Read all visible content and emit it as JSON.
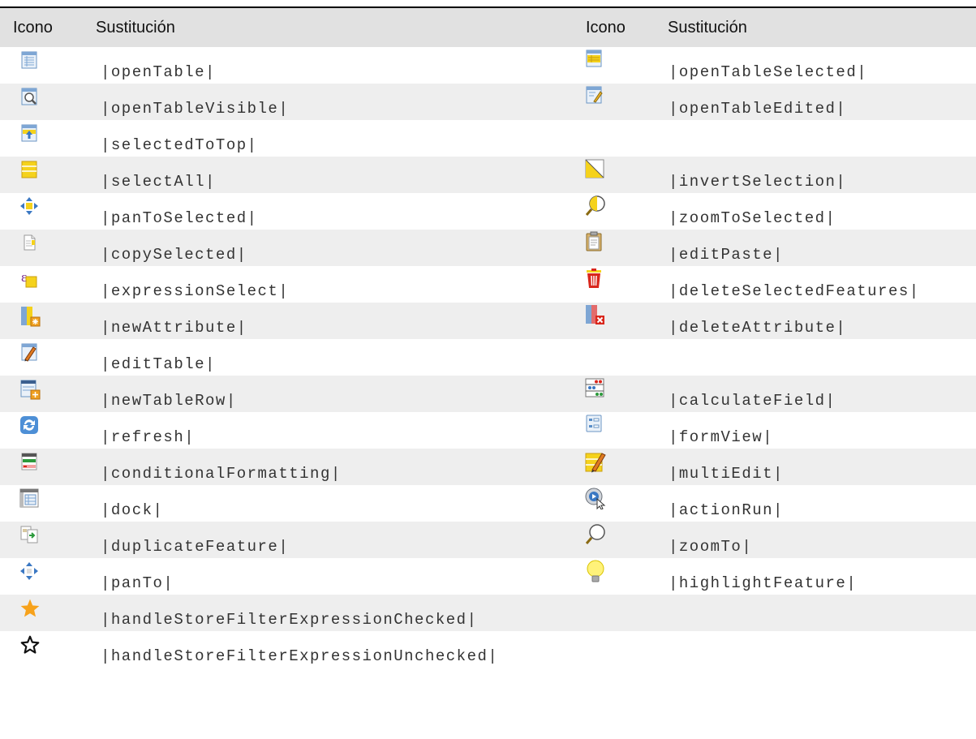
{
  "table": {
    "headers": {
      "icon": "Icono",
      "substitution": "Sustitución",
      "icon2": "Icono",
      "substitution2": "Sustitución"
    },
    "rows": [
      {
        "left": {
          "icon": "open-table-icon",
          "text": "|openTable|"
        },
        "right": {
          "icon": "open-table-selected-icon",
          "text": "|openTableSelected|"
        }
      },
      {
        "left": {
          "icon": "open-table-visible-icon",
          "text": "|openTableVisible|"
        },
        "right": {
          "icon": "open-table-edited-icon",
          "text": "|openTableEdited|"
        }
      },
      {
        "left": {
          "icon": "selected-to-top-icon",
          "text": "|selectedToTop|"
        },
        "right": {
          "icon": "",
          "text": ""
        }
      },
      {
        "left": {
          "icon": "select-all-icon",
          "text": "|selectAll|"
        },
        "right": {
          "icon": "invert-selection-icon",
          "text": "|invertSelection|"
        }
      },
      {
        "left": {
          "icon": "pan-to-selected-icon",
          "text": "|panToSelected|"
        },
        "right": {
          "icon": "zoom-to-selected-icon",
          "text": "|zoomToSelected|"
        }
      },
      {
        "left": {
          "icon": "copy-selected-icon",
          "text": "|copySelected|"
        },
        "right": {
          "icon": "edit-paste-icon",
          "text": "|editPaste|"
        }
      },
      {
        "left": {
          "icon": "expression-select-icon",
          "text": "|expressionSelect|"
        },
        "right": {
          "icon": "delete-selected-features-icon",
          "text": "|deleteSelectedFeatures|"
        }
      },
      {
        "left": {
          "icon": "new-attribute-icon",
          "text": "|newAttribute|"
        },
        "right": {
          "icon": "delete-attribute-icon",
          "text": "|deleteAttribute|"
        }
      },
      {
        "left": {
          "icon": "edit-table-icon",
          "text": "|editTable|"
        },
        "right": {
          "icon": "",
          "text": ""
        }
      },
      {
        "left": {
          "icon": "new-table-row-icon",
          "text": "|newTableRow|"
        },
        "right": {
          "icon": "calculate-field-icon",
          "text": "|calculateField|"
        }
      },
      {
        "left": {
          "icon": "refresh-icon",
          "text": "|refresh|"
        },
        "right": {
          "icon": "form-view-icon",
          "text": "|formView|"
        }
      },
      {
        "left": {
          "icon": "conditional-formatting-icon",
          "text": "|conditionalFormatting|"
        },
        "right": {
          "icon": "multi-edit-icon",
          "text": "|multiEdit|"
        }
      },
      {
        "left": {
          "icon": "dock-icon",
          "text": "|dock|"
        },
        "right": {
          "icon": "action-run-icon",
          "text": "|actionRun|"
        }
      },
      {
        "left": {
          "icon": "duplicate-feature-icon",
          "text": "|duplicateFeature|"
        },
        "right": {
          "icon": "zoom-to-icon",
          "text": "|zoomTo|"
        }
      },
      {
        "left": {
          "icon": "pan-to-icon",
          "text": "|panTo|"
        },
        "right": {
          "icon": "highlight-feature-icon",
          "text": "|highlightFeature|"
        }
      },
      {
        "left": {
          "icon": "star-filled-icon",
          "text": "|handleStoreFilterExpressionChecked|"
        },
        "right": {
          "icon": "",
          "text": ""
        }
      },
      {
        "left": {
          "icon": "star-outline-icon",
          "text": "|handleStoreFilterExpressionUnchecked|"
        },
        "right": {
          "icon": "",
          "text": ""
        }
      }
    ]
  },
  "colors": {
    "header_bg": "#e1e1e1",
    "row_alt_bg": "#eeeeee",
    "text": "#333333",
    "table_blue": "#5b8fc9",
    "selection_yellow": "#f5d21c",
    "delete_red": "#d9261c",
    "star_orange": "#f7a21b"
  }
}
